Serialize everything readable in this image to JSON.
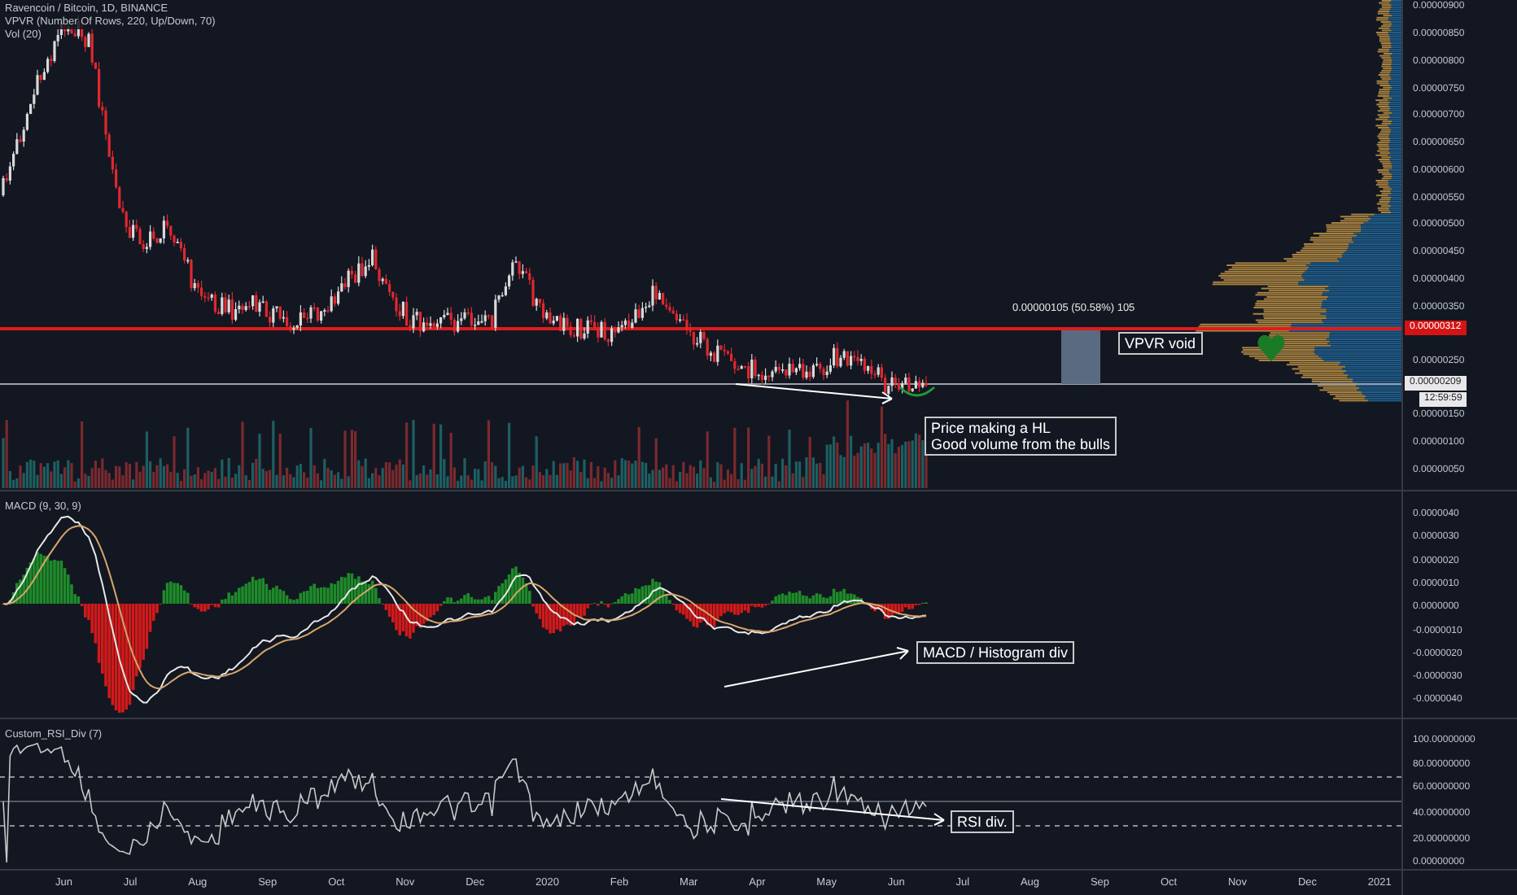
{
  "main_pane": {
    "legend": [
      "Ravencoin / Bitcoin, 1D, BINANCE",
      "VPVR (Number Of Rows, 220, Up/Down, 70)",
      "Vol (20)"
    ],
    "measure_label": "0.00000105 (50.58%) 105",
    "notes": [
      {
        "lines": [
          "VPVR void"
        ]
      },
      {
        "lines": [
          "Price making a HL",
          "Good volume from the bulls"
        ]
      }
    ]
  },
  "price_axis": {
    "labels": [
      "0.00000900",
      "0.00000850",
      "0.00000800",
      "0.00000750",
      "0.00000700",
      "0.00000650",
      "0.00000600",
      "0.00000550",
      "0.00000500",
      "0.00000450",
      "0.00000400",
      "0.00000350",
      "0.00000250",
      "0.00000150",
      "0.00000100",
      "0.00000050"
    ],
    "line_level": "0.00000312",
    "last_price": "0.00000209",
    "countdown": "12:59:59"
  },
  "macd_pane": {
    "title": "MACD (9, 30, 9)",
    "axis_labels": [
      "0.0000040",
      "0.0000030",
      "0.0000020",
      "0.0000010",
      "0.0000000",
      "-0.0000010",
      "-0.0000020",
      "-0.0000030",
      "-0.0000040"
    ],
    "note": "MACD / Histogram div"
  },
  "rsi_pane": {
    "title": "Custom_RSI_Div (7)",
    "axis_labels": [
      "100.00000000",
      "80.00000000",
      "60.00000000",
      "40.00000000",
      "20.00000000",
      "0.00000000"
    ],
    "note": "RSI div."
  },
  "time_axis": {
    "labels": [
      "Jun",
      "Jul",
      "Aug",
      "Sep",
      "Oct",
      "Nov",
      "Dec",
      "2020",
      "Feb",
      "Mar",
      "Apr",
      "May",
      "Jun",
      "Jul",
      "Aug",
      "Sep",
      "Oct",
      "Nov",
      "Dec",
      "2021"
    ]
  }
}
